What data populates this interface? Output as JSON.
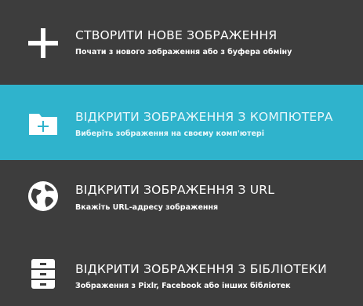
{
  "menu": {
    "items": [
      {
        "title": "СТВОРИТИ НОВЕ ЗОБРАЖЕННЯ",
        "subtitle": "Почати з нового зображення або з буфера обміну",
        "icon": "plus-icon"
      },
      {
        "title": "ВІДКРИТИ ЗОБРАЖЕННЯ З КОМПЮТЕРА",
        "subtitle": "Виберіть зображення на своєму комп'ютері",
        "icon": "folder-icon"
      },
      {
        "title": "ВІДКРИТИ ЗОБРАЖЕННЯ З URL",
        "subtitle": "Вкажіть URL-адресу зображення",
        "icon": "globe-icon"
      },
      {
        "title": "ВІДКРИТИ ЗОБРАЖЕННЯ З БІБЛІОТЕКИ",
        "subtitle": "Зображення з Pixlr, Facebook або інших бібліотек",
        "icon": "library-icon"
      }
    ]
  },
  "colors": {
    "background": "#3d3d3d",
    "highlight": "#2fb3cc",
    "text": "#ffffff"
  }
}
